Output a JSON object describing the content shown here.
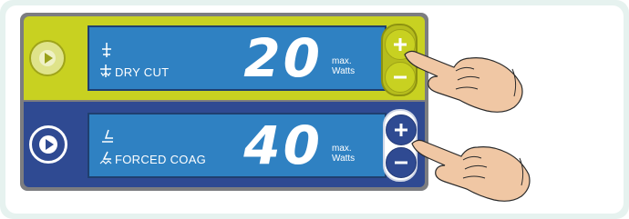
{
  "panel": {
    "channels": [
      {
        "name": "dry-cut",
        "mode_label": "DRY CUT",
        "value": "20",
        "unit_line1": "max.",
        "unit_line2": "Watts",
        "colors": {
          "row": "#c8d121",
          "display": "#2f81c2"
        }
      },
      {
        "name": "forced-coag",
        "mode_label": "FORCED COAG",
        "value": "40",
        "unit_line1": "max.",
        "unit_line2": "Watts",
        "colors": {
          "row": "#2f4a92",
          "display": "#2f81c2"
        }
      }
    ],
    "icons": {
      "mode_button": "play-icon",
      "increase": "plus-icon",
      "decrease": "minus-icon",
      "pointer": "pointing-hand-icon"
    }
  }
}
